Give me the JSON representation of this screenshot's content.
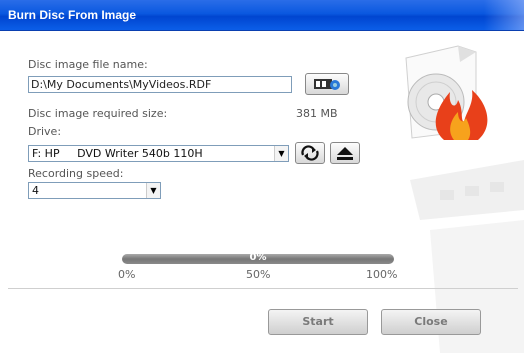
{
  "window": {
    "title": "Burn Disc From Image"
  },
  "image_file": {
    "label": "Disc image file name:",
    "value": "D:\\My Documents\\MyVideos.RDF",
    "browse_icon": "film-browse-icon"
  },
  "required_size": {
    "label": "Disc image required size:",
    "value": "381 MB"
  },
  "drive": {
    "label": "Drive:",
    "selected": "F: HP     DVD Writer 540b 110H",
    "refresh_icon": "refresh-icon",
    "eject_icon": "eject-icon"
  },
  "speed": {
    "label": "Recording speed:",
    "selected": "4"
  },
  "progress": {
    "percent_text": "0%",
    "value": 0,
    "tick_start": "0%",
    "tick_mid": "50%",
    "tick_end": "100%"
  },
  "buttons": {
    "start": "Start",
    "close": "Close"
  },
  "colors": {
    "titlebar": "#0a58e0",
    "text": "#444444",
    "accent_fire": "#e8401a"
  }
}
